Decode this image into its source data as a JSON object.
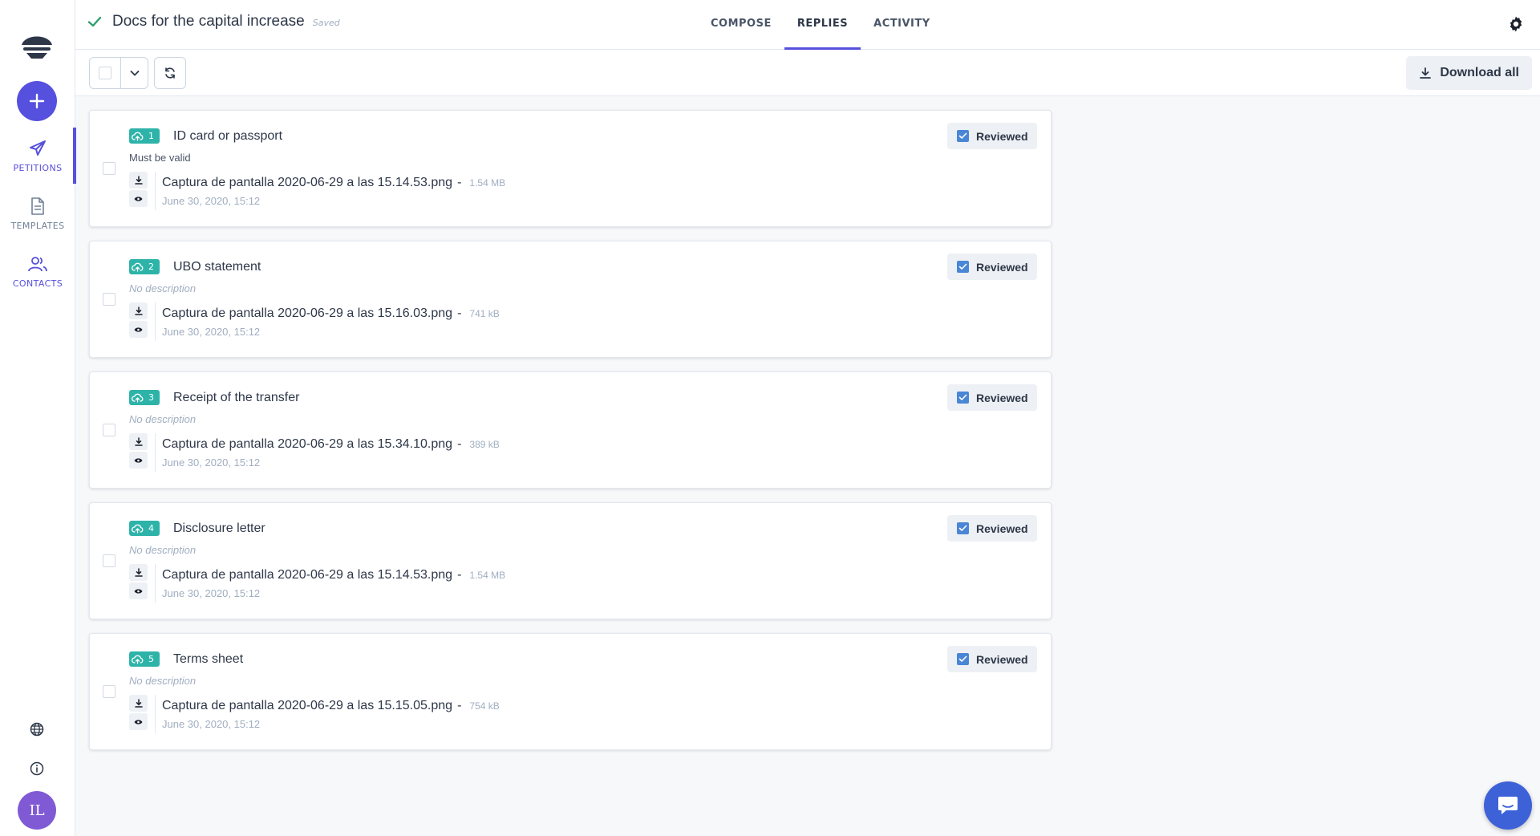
{
  "sidebar": {
    "nav": [
      {
        "label": "PETITIONS",
        "icon": "paper-plane-icon"
      },
      {
        "label": "TEMPLATES",
        "icon": "document-icon"
      },
      {
        "label": "CONTACTS",
        "icon": "users-icon"
      }
    ],
    "avatar": "IL"
  },
  "header": {
    "title": "Docs for the capital increase",
    "status": "Saved",
    "tabs": [
      "COMPOSE",
      "REPLIES",
      "ACTIVITY"
    ],
    "active_tab": "REPLIES"
  },
  "toolbar": {
    "download_all": "Download all"
  },
  "replies": [
    {
      "number": "1",
      "title": "ID card or passport",
      "description": "Must be valid",
      "file": "Captura de pantalla 2020-06-29 a las 15.14.53.png",
      "size": "1.54 MB",
      "date": "June 30, 2020, 15:12",
      "status": "Reviewed"
    },
    {
      "number": "2",
      "title": "UBO statement",
      "description": "No description",
      "file": "Captura de pantalla 2020-06-29 a las 15.16.03.png",
      "size": "741 kB",
      "date": "June 30, 2020, 15:12",
      "status": "Reviewed"
    },
    {
      "number": "3",
      "title": "Receipt of the transfer",
      "description": "No description",
      "file": "Captura de pantalla 2020-06-29 a las 15.34.10.png",
      "size": "389 kB",
      "date": "June 30, 2020, 15:12",
      "status": "Reviewed"
    },
    {
      "number": "4",
      "title": "Disclosure letter",
      "description": "No description",
      "file": "Captura de pantalla 2020-06-29 a las 15.14.53.png",
      "size": "1.54 MB",
      "date": "June 30, 2020, 15:12",
      "status": "Reviewed"
    },
    {
      "number": "5",
      "title": "Terms sheet",
      "description": "No description",
      "file": "Captura de pantalla 2020-06-29 a las 15.15.05.png",
      "size": "754 kB",
      "date": "June 30, 2020, 15:12",
      "status": "Reviewed"
    }
  ],
  "colors": {
    "accent": "#5650de",
    "badge": "#2eb3a9",
    "reviewed_check": "#4a86d6",
    "chat": "#3d62d8"
  }
}
